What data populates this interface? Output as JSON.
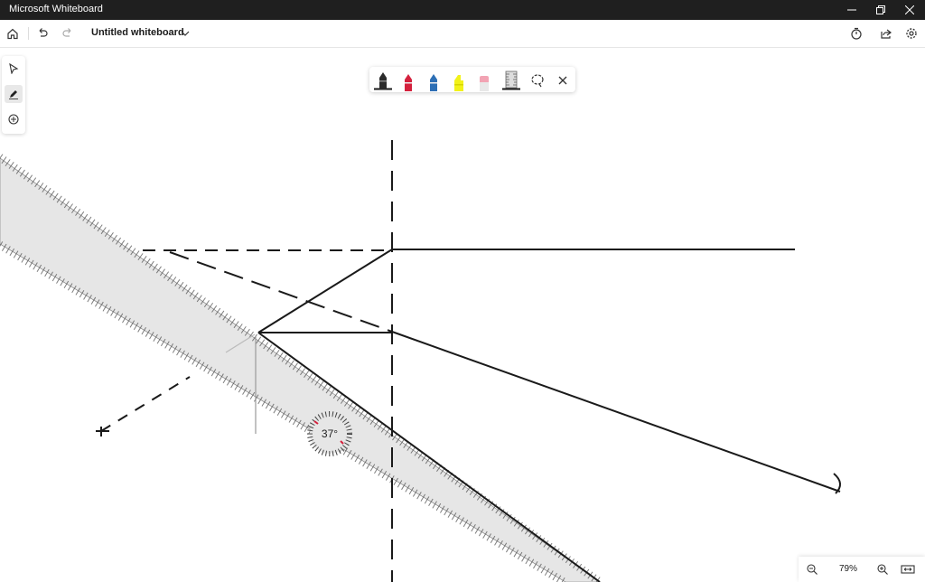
{
  "window": {
    "title": "Microsoft Whiteboard"
  },
  "toolbar": {
    "doc_title": "Untitled whiteboard"
  },
  "ruler": {
    "angle_label": "37°"
  },
  "zoom": {
    "level": "79%"
  },
  "colors": {
    "titlebar_bg": "#1f1f1f",
    "ruler_fill": "#e6e6e6",
    "ink": "#1a1a1a",
    "pen_red": "#d4213d",
    "pen_blue": "#2d6fb5",
    "highlighter_yellow": "#f2f21a",
    "pen_pink": "#f2a3b3"
  }
}
